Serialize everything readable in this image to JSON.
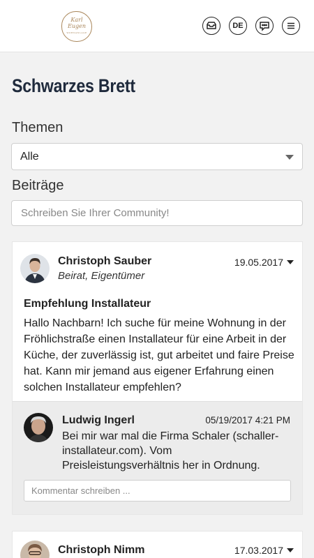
{
  "header": {
    "logo_text_line1": "Karl",
    "logo_text_line2": "Eugen",
    "logo_subtext": "WOHNANLAGE",
    "lang_label": "DE"
  },
  "page": {
    "title": "Schwarzes Brett",
    "topics_label": "Themen",
    "topics_selected": "Alle",
    "posts_label": "Beiträge",
    "post_placeholder": "Schreiben Sie Ihrer Community!"
  },
  "posts": [
    {
      "author": "Christoph Sauber",
      "role": "Beirat, Eigentümer",
      "date": "19.05.2017",
      "title": "Empfehlung Installateur",
      "body": "Hallo Nachbarn! Ich suche für meine Wohnung in der Fröhlichstraße einen Installateur für eine Arbeit in der Küche, der zuverlässig ist, gut arbeitet und faire Preise hat. Kann mir jemand aus eigener Erfahrung einen solchen Installateur empfehlen?",
      "comments": [
        {
          "author": "Ludwig Ingerl",
          "date": "05/19/2017 4:21 PM",
          "body": "Bei mir war mal die Firma Schaler (schaller-installateur.com). Vom Preisleistungsverhältnis her in Ordnung."
        }
      ],
      "comment_placeholder": "Kommentar schreiben ..."
    },
    {
      "author": "Christoph Nimm",
      "date": "17.03.2017"
    }
  ]
}
